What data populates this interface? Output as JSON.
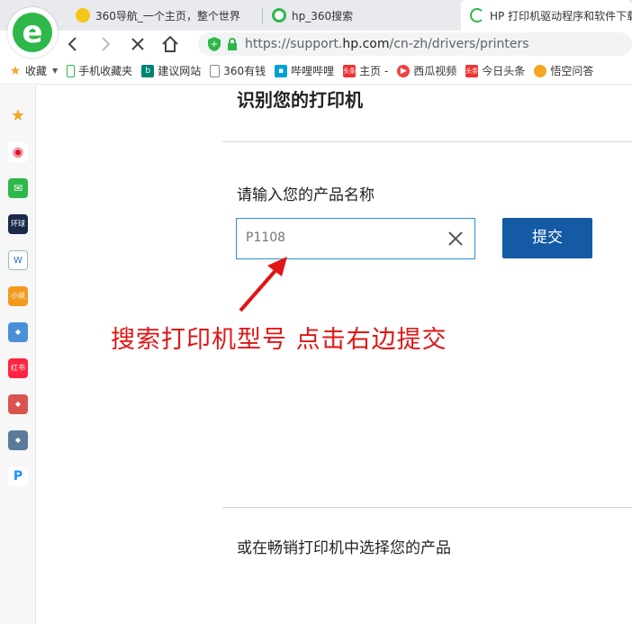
{
  "tabs": [
    {
      "title": "360导航_一个主页，整个世界"
    },
    {
      "title": "hp_360搜索"
    },
    {
      "title": "HP 打印机驱动程序和软件下载"
    }
  ],
  "address": {
    "scheme": "https://support.",
    "domain": "hp.com",
    "path": "/cn-zh/drivers/printers"
  },
  "bookmarks": [
    {
      "label": "收藏",
      "icon": "star-icon"
    },
    {
      "label": "手机收藏夹",
      "icon": "phone-icon"
    },
    {
      "label": "建议网站",
      "icon": "bing-icon"
    },
    {
      "label": "360有钱",
      "icon": "page-icon"
    },
    {
      "label": "哔哩哔哩",
      "icon": "bilibili-icon"
    },
    {
      "label": "主页 -",
      "icon": "toutiao-icon"
    },
    {
      "label": "西瓜视频",
      "icon": "xigua-icon"
    },
    {
      "label": "今日头条",
      "icon": "toutiao-icon"
    },
    {
      "label": "悟空问答",
      "icon": "wukong-icon"
    }
  ],
  "page": {
    "title": "识别您的打印机",
    "input_label": "请输入您的产品名称",
    "input_value": "P1108",
    "submit_label": "提交",
    "bestseller_label": "或在畅销打印机中选择您的产品"
  },
  "annotation": "搜索打印机型号  点击右边提交",
  "colors": {
    "accent": "#145aa5",
    "annotation": "#e21515",
    "focus_border": "#2c8fd6"
  }
}
